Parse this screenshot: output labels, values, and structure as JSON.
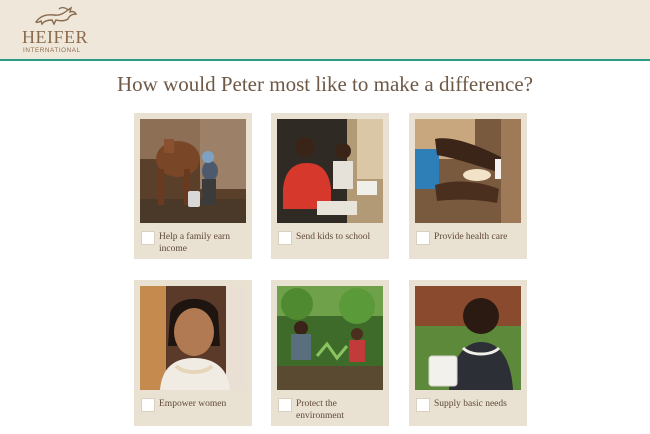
{
  "header": {
    "logo_text": "HEIFER",
    "logo_subtext": "INTERNATIONAL"
  },
  "question": "How would Peter most like to make a difference?",
  "options": [
    {
      "label": "Help a family earn income",
      "checked": false
    },
    {
      "label": "Send kids to school",
      "checked": false
    },
    {
      "label": "Provide health care",
      "checked": false
    },
    {
      "label": "Empower women",
      "checked": false
    },
    {
      "label": "Protect the environment",
      "checked": false
    },
    {
      "label": "Supply basic needs",
      "checked": false
    }
  ],
  "colors": {
    "header_bg": "#efe8da",
    "accent_rule": "#2b9c83",
    "card_bg": "#e9e1d1",
    "heading_text": "#6e5846"
  }
}
